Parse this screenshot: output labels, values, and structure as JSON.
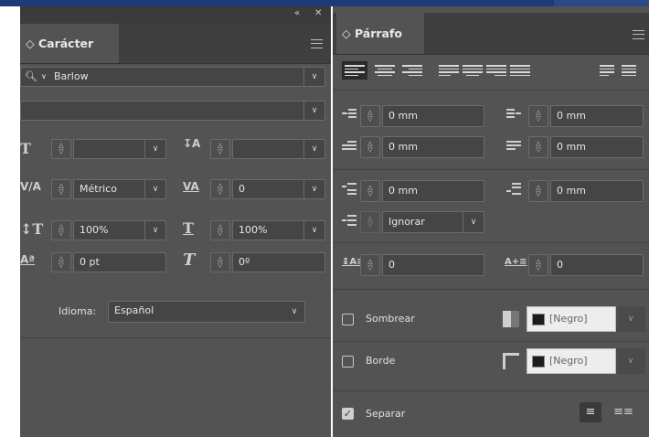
{
  "colors": {
    "panel_bg": "#535353",
    "tab_bar": "#3f3f3f",
    "field_bg": "#454545",
    "accent_top": "#1d3b78"
  },
  "window": {
    "collapse_label": "«",
    "close_label": "✕"
  },
  "character": {
    "tab_title": "◇ Carácter",
    "font_family": "Barlow",
    "font_style": "",
    "font_size": "",
    "leading": "",
    "kerning": "Métrico",
    "tracking": "0",
    "vertical_scale": "100%",
    "horizontal_scale": "100%",
    "baseline_shift": "0 pt",
    "skew": "0º",
    "language_label": "Idioma:",
    "language": "Español"
  },
  "paragraph": {
    "tab_title": "◇ Párrafo",
    "left_indent": "0 mm",
    "right_indent": "0 mm",
    "first_line_indent": "0 mm",
    "last_line_indent": "0 mm",
    "space_before": "0 mm",
    "space_after": "0 mm",
    "align_to_grid": "Ignorar",
    "drop_cap_lines": "0",
    "drop_cap_chars": "0",
    "shading_label": "Sombrear",
    "shading_color": "[Negro]",
    "border_label": "Borde",
    "border_color": "[Negro]",
    "separate_label": "Separar",
    "separate_checked": true
  }
}
